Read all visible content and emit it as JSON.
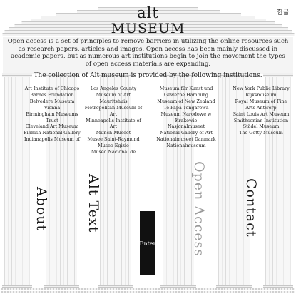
{
  "brand": {
    "line1": "alt",
    "line2": "MUSEUM"
  },
  "language_toggle": "한글",
  "intro": "Open access is a set of principles to remove barriers in utilizing the online resources such as research papers, articles and images. Open access has been mainly discussed in academic papers, but as numerous art institutions begin to join the movement the types of open access materials are expanding.",
  "provided_by": "The collection of Alt museum is provided by the following institutions.",
  "institutions": [
    [
      "Art Institute of Chicago",
      "Barnes Foundation",
      "Belvedere Museum Vienna",
      "Birmingham Museums Trust",
      "Cleveland Art Museum",
      "Finnish National Gallery",
      "Indianapolis Museum of"
    ],
    [
      "Los Angeles County Museum of Art",
      "Mauritshuis",
      "Metropolitan Museum of Art",
      "Minneapolis Institute of Art",
      "Munch Museet",
      "Musee Saint-Raymond",
      "Museo Egizio",
      "Museo Nacional de"
    ],
    [
      "Museum für Kunst und Gewerbe Hamburg",
      "Museum of New Zealand Te Papa Tongarewa",
      "Muzeum Narodowe w Krakowie",
      "Nasjonalmuseet",
      "National Gallery of Art",
      "Nationalmuseet Danmark",
      "Nationalmuseum"
    ],
    [
      "New York Public Library",
      "Rijksmuseum",
      "Royal Museum of Fine Arts Antwerp",
      "Saint Louis Art Museum",
      "Smithsonian Institution",
      "Städel Museum",
      "The Getty Museum"
    ]
  ],
  "nav": {
    "about": "About",
    "alt_text": "Alt Text",
    "open_access": "Open Access",
    "contact": "Contact"
  },
  "enter_label": "Enter",
  "colors": {
    "background": "#ffffff",
    "column": "#f0f0f0",
    "enter_button": "#111111",
    "muted_link": "#9a9a9a"
  }
}
